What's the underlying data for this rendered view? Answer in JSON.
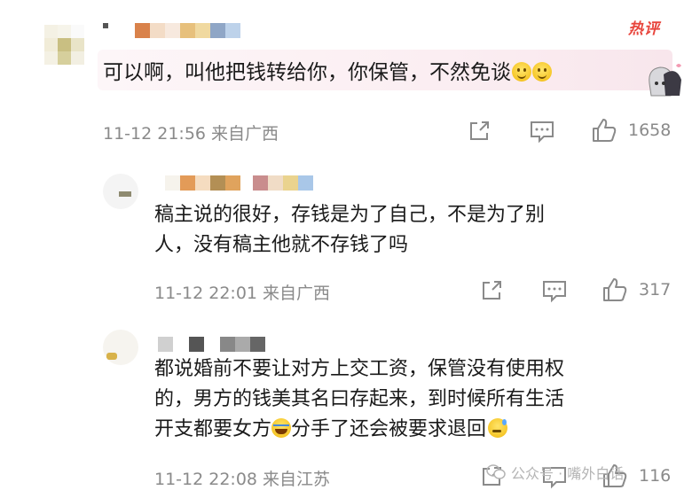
{
  "badge": {
    "hot": "热评"
  },
  "comment": {
    "text": "可以啊，叫他把钱转给你，你保管，不然免谈",
    "emoji": [
      "smile-emoji",
      "smile-emoji"
    ],
    "meta": "11-12 21:56 来自广西",
    "likes": "1658"
  },
  "replies": [
    {
      "line1": "稿主说的很好，存钱是为了自己，不是为了别",
      "line2": "人，没有稿主他就不存钱了吗",
      "meta": "11-12 22:01 来自广西",
      "likes": "317"
    },
    {
      "line1": "都说婚前不要让对方上交工资，保管没有使用权",
      "line2": "的，男方的钱美其名曰存起来，到时候所有生活",
      "line3_a": "开支都要女方",
      "line3_b": "分手了还会被要求退回",
      "meta": "11-12 22:08 来自江苏",
      "likes": "116"
    }
  ],
  "watermark": {
    "text": "公众号 · 嘴外白话"
  },
  "colors": {
    "hot": "#e8453c",
    "meta": "#8a8a8a",
    "text": "#1a1a1a",
    "bubble": "#fbeef2"
  },
  "icons": [
    "share-icon",
    "comment-icon",
    "like-icon"
  ]
}
